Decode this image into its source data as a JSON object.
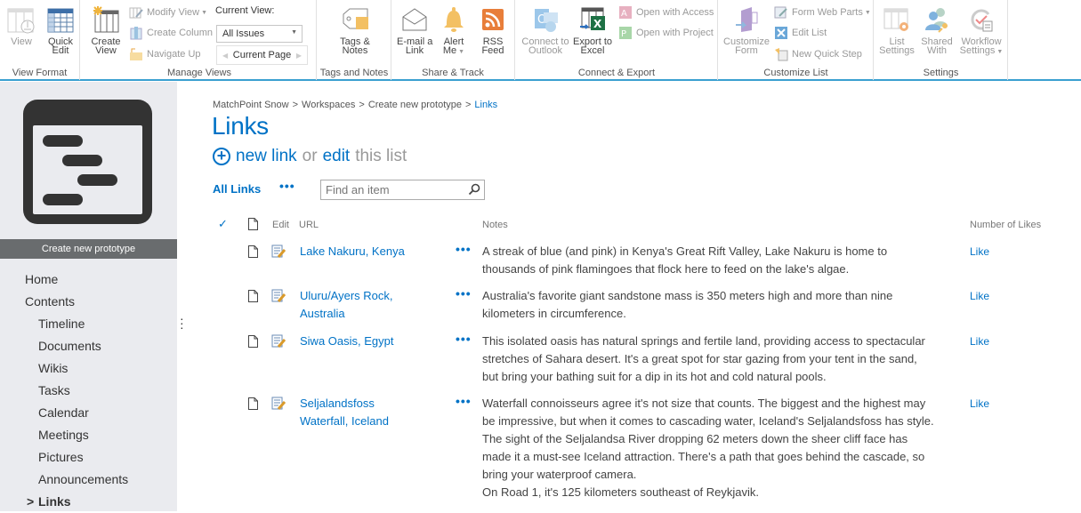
{
  "ribbon": {
    "groups": {
      "view_format": "View Format",
      "manage_views": "Manage Views",
      "tags_notes": "Tags and Notes",
      "share_track": "Share & Track",
      "connect_export": "Connect & Export",
      "customize_list": "Customize List",
      "settings": "Settings"
    },
    "view": "View",
    "quick_edit": "Quick\nEdit",
    "create_view": "Create\nView",
    "modify_view": "Modify View",
    "create_column": "Create Column",
    "navigate_up": "Navigate Up",
    "current_view_label": "Current View:",
    "current_view_value": "All Issues",
    "current_page": "Current Page",
    "tags_notes": "Tags &\nNotes",
    "email_link": "E-mail a\nLink",
    "alert_me": "Alert\nMe",
    "rss_feed": "RSS\nFeed",
    "connect_outlook": "Connect to\nOutlook",
    "export_excel": "Export to\nExcel",
    "open_access": "Open with Access",
    "open_project": "Open with Project",
    "customize_form": "Customize\nForm",
    "form_web_parts": "Form Web Parts",
    "edit_list": "Edit List",
    "new_quick_step": "New Quick Step",
    "list_settings": "List\nSettings",
    "shared_with": "Shared\nWith",
    "workflow_settings": "Workflow\nSettings"
  },
  "sidebar": {
    "site_name": "Create new prototype",
    "nav": [
      {
        "label": "Home",
        "level": 0
      },
      {
        "label": "Contents",
        "level": 0
      },
      {
        "label": "Timeline",
        "level": 1
      },
      {
        "label": "Documents",
        "level": 1
      },
      {
        "label": "Wikis",
        "level": 1
      },
      {
        "label": "Tasks",
        "level": 1
      },
      {
        "label": "Calendar",
        "level": 1
      },
      {
        "label": "Meetings",
        "level": 1
      },
      {
        "label": "Pictures",
        "level": 1
      },
      {
        "label": "Announcements",
        "level": 1
      },
      {
        "label": "Links",
        "level": 0,
        "active": true
      }
    ]
  },
  "breadcrumb": [
    "MatchPoint Snow",
    "Workspaces",
    "Create new prototype",
    "Links"
  ],
  "breadcrumb_sep": ">",
  "page_title": "Links",
  "actions": {
    "new_link": "new link",
    "or": "or",
    "edit": "edit",
    "this_list": "this list"
  },
  "view": {
    "current": "All Links",
    "more": "•••",
    "search_placeholder": "Find an item"
  },
  "table": {
    "headers": {
      "edit": "Edit",
      "url": "URL",
      "notes": "Notes",
      "likes": "Number of Likes"
    },
    "rows": [
      {
        "title": "Lake Nakuru, Kenya",
        "notes": "A streak of blue (and pink) in Kenya's Great Rift Valley, Lake Nakuru is home to\nthousands of pink flamingoes that flock here to feed on the lake's algae.",
        "like": "Like"
      },
      {
        "title": "Uluru/Ayers Rock,\nAustralia",
        "notes": "Australia's favorite giant sandstone mass is 350 meters high and more than nine\nkilometers in circumference.",
        "like": "Like"
      },
      {
        "title": "Siwa Oasis, Egypt",
        "notes": "This isolated oasis has natural springs and fertile land, providing access to spectacular\nstretches of Sahara desert. It's a great spot for star gazing from your tent in the sand,\nbut bring your bathing suit for a dip in its hot and cold natural pools.",
        "like": "Like"
      },
      {
        "title": "Seljalandsfoss\nWaterfall, Iceland",
        "notes": "Waterfall connoisseurs agree it's not size that counts. The biggest and the highest may\nbe impressive, but when it comes to cascading water, Iceland's Seljalandsfoss has style.\nThe sight of the Seljalandsa River dropping 62 meters down the sheer cliff face has\nmade it a must-see Iceland attraction. There's a path that goes behind the cascade, so\nbring your waterproof camera.\nOn Road 1, it's 125 kilometers southeast of Reykjavik.",
        "like": "Like"
      }
    ]
  },
  "colors": {
    "accent": "#0072c6",
    "ribbon_border": "#3aa0d0",
    "sidebar_bg": "#eaebef",
    "site_label_bg": "#696c6e"
  }
}
